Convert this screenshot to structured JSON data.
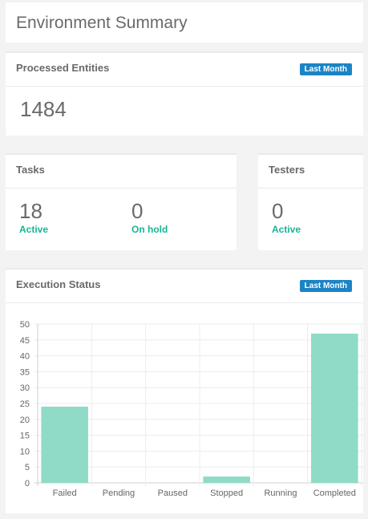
{
  "header": {
    "title": "Environment Summary"
  },
  "processed": {
    "title": "Processed Entities",
    "badge": "Last Month",
    "value": "1484"
  },
  "tasks": {
    "title": "Tasks",
    "active_value": "18",
    "active_label": "Active",
    "onhold_value": "0",
    "onhold_label": "On hold"
  },
  "testers": {
    "title": "Testers",
    "active_value": "0",
    "active_label": "Active"
  },
  "execution": {
    "title": "Execution Status",
    "badge": "Last Month"
  },
  "colors": {
    "badge": "#1c84c6",
    "accent": "#1ab394",
    "bar": "#8fdbc8"
  },
  "chart_data": {
    "type": "bar",
    "categories": [
      "Failed",
      "Pending",
      "Paused",
      "Stopped",
      "Running",
      "Completed"
    ],
    "values": [
      24,
      0,
      0,
      2,
      0,
      47
    ],
    "ylim": [
      0,
      50
    ],
    "yticks": [
      0,
      5,
      10,
      15,
      20,
      25,
      30,
      35,
      40,
      45,
      50
    ],
    "grid": true
  }
}
